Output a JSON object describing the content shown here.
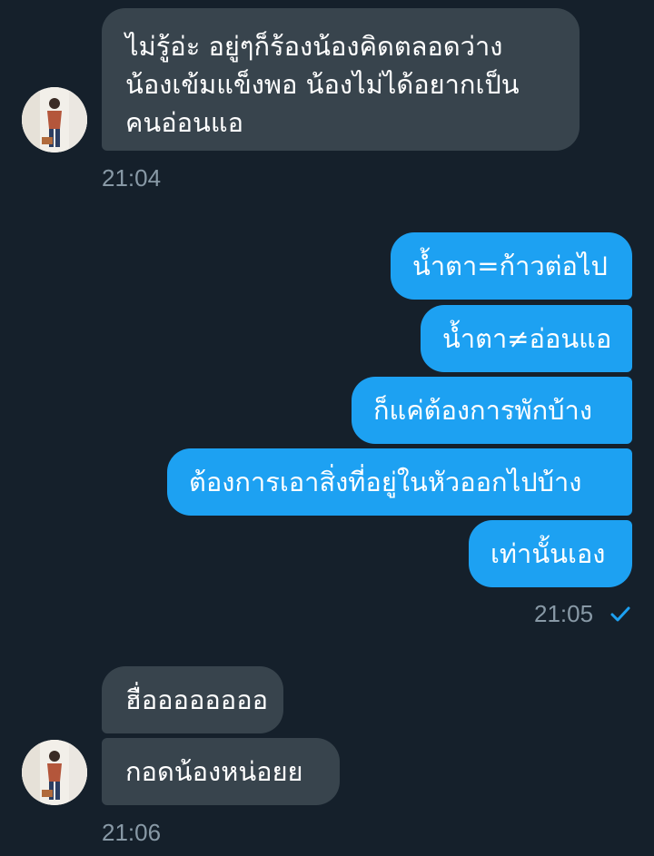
{
  "colors": {
    "background": "#15202b",
    "incoming_bubble": "#38444d",
    "outgoing_bubble": "#1da1f2",
    "timestamp": "#8899a6",
    "read_check": "#1da1f2"
  },
  "messages": {
    "group1": {
      "bubble1": "ไม่รู้อ่ะ อยู่ๆก็ร้องน้องคิดตลอดว่าง\nน้องเข้มแข็งพอ น้องไม่ได้อยากเป็น\nคนอ่อนแอ",
      "time": "21:04"
    },
    "group2": {
      "bubble1": "น้ำตา=ก้าวต่อไป",
      "bubble2": "น้ำตา≠อ่อนแอ",
      "bubble3": "ก็แค่ต้องการพักบ้าง",
      "bubble4": "ต้องการเอาสิ่งที่อยู่ในหัวออกไปบ้าง",
      "bubble5": "เท่านั้นเอง",
      "time": "21:05",
      "status_icon": "read-check-icon"
    },
    "group3": {
      "bubble1": "ฮื่ออออออออ",
      "bubble2": "กอดน้องหน่อยย",
      "time": "21:06"
    }
  },
  "avatars": {
    "avatar1": "user-avatar",
    "avatar2": "user-avatar"
  }
}
